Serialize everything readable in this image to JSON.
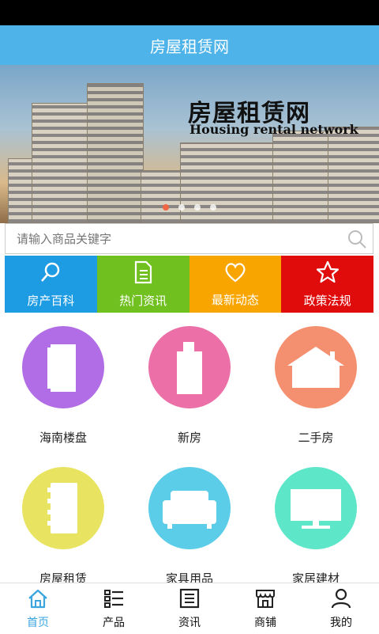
{
  "header": {
    "title": "房屋租赁网"
  },
  "banner": {
    "title": "房屋租赁网",
    "subtitle": "Housing rental network",
    "slide_count": 4,
    "active_slide": 1
  },
  "search": {
    "placeholder": "请输入商品关键字",
    "icon": "search-icon"
  },
  "quick_tabs": [
    {
      "label": "房产百科",
      "icon": "search-icon",
      "color": "#1d9be3"
    },
    {
      "label": "热门资讯",
      "icon": "document-icon",
      "color": "#70c020"
    },
    {
      "label": "最新动态",
      "icon": "heart-icon",
      "color": "#f8a500"
    },
    {
      "label": "政策法规",
      "icon": "star-icon",
      "color": "#e00b0b"
    }
  ],
  "categories": [
    {
      "label": "海南楼盘",
      "icon": "building-icon",
      "color": "#b16de6"
    },
    {
      "label": "新房",
      "icon": "tower-icon",
      "color": "#ec6fa7"
    },
    {
      "label": "二手房",
      "icon": "house-icon",
      "color": "#f49070"
    },
    {
      "label": "房屋租赁",
      "icon": "notebook-icon",
      "color": "#e8e461"
    },
    {
      "label": "家具用品",
      "icon": "sofa-icon",
      "color": "#5ccde8"
    },
    {
      "label": "家居建材",
      "icon": "monitor-icon",
      "color": "#5ee6c9"
    }
  ],
  "bottom_nav": [
    {
      "label": "首页",
      "icon": "home-icon",
      "active": true
    },
    {
      "label": "产品",
      "icon": "list-icon",
      "active": false
    },
    {
      "label": "资讯",
      "icon": "news-icon",
      "active": false
    },
    {
      "label": "商铺",
      "icon": "shop-icon",
      "active": false
    },
    {
      "label": "我的",
      "icon": "user-icon",
      "active": false
    }
  ]
}
